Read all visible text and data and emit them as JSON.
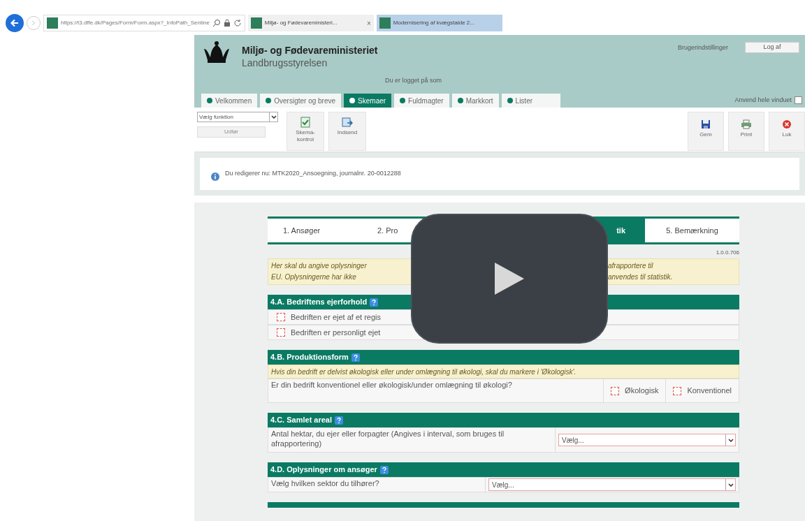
{
  "browser": {
    "url": "https://t3.dffe.dk/Pages/Form/Form.aspx?_InfoPath_Sentine",
    "tabs": [
      {
        "title": "Miljø- og Fødevareministeri...",
        "selected": false,
        "close": "×"
      },
      {
        "title": "Modernisering af kvægstalde 2...",
        "selected": true
      }
    ]
  },
  "header": {
    "ministry": "Miljø- og Fødevareministeriet",
    "agency": "Landbrugsstyrelsen",
    "logged_in": "Du er logget på som",
    "user_settings": "Brugerindstillinger",
    "logout": "Log af"
  },
  "nav_tabs": [
    {
      "label": "Velkommen",
      "selected": false
    },
    {
      "label": "Oversigter og breve",
      "selected": false
    },
    {
      "label": "Skemaer",
      "selected": true
    },
    {
      "label": "Fuldmagter",
      "selected": false
    },
    {
      "label": "Markkort",
      "selected": false
    },
    {
      "label": "Lister",
      "selected": false
    }
  ],
  "full_window": {
    "label": "Anvend hele vinduet",
    "checked": false
  },
  "toolbar": {
    "function_select": "Vælg funktion",
    "run_button": {
      "label": "Udfør",
      "disabled": true
    },
    "left_buttons": [
      {
        "label": "Skema-kontrol",
        "kind": "check"
      },
      {
        "label": "Indsend",
        "kind": "send"
      }
    ],
    "right_buttons": [
      {
        "label": "Gem",
        "kind": "save"
      },
      {
        "label": "Print",
        "kind": "print"
      },
      {
        "label": "Luk",
        "kind": "close"
      }
    ]
  },
  "info": "Du redigerer nu: MTK2020_Ansoegning, journalnr. 20-0012288",
  "steps": [
    {
      "label": "1. Ansøger",
      "selected": false
    },
    {
      "label": "2. Pro",
      "selected": false
    },
    {
      "label": "tik",
      "selected": true
    },
    {
      "label": "5. Bemærkning",
      "selected": false
    }
  ],
  "version": "1.0.0.706",
  "intro": [
    {
      "left": "Her skal du angive oplysninger",
      "right": "afrapportere til"
    },
    {
      "left": "EU. Oplysningerne har ikke",
      "right": "anvendes til statistik."
    }
  ],
  "sections": [
    {
      "title": "4.A. Bedriftens ejerforhold",
      "rows": [
        {
          "kind": "checkbox",
          "label": "Bedriften er ejet af et regis",
          "checked": false
        },
        {
          "kind": "checkbox",
          "label": "Bedriften er personligt ejet",
          "checked": false
        }
      ]
    },
    {
      "title": "4.B. Produktionsform",
      "rows": [
        {
          "kind": "note",
          "label": "Hvis din bedrift er delvist økologisk eller under omlægning til økologi, skal du markere i 'Økologisk'."
        },
        {
          "kind": "options",
          "label": "Er din bedrift konventionel eller økologisk/under omlægning til økologi?",
          "options": [
            {
              "label": "Økologisk",
              "checked": false
            },
            {
              "label": "Konventionel",
              "checked": false
            }
          ]
        }
      ]
    },
    {
      "title": "4.C. Samlet areal",
      "rows": [
        {
          "kind": "select",
          "label": "Antal hektar, du ejer eller forpagter (Angives i interval, som bruges til afrapportering)",
          "placeholder": "Vælg..."
        }
      ]
    },
    {
      "title": "4.D. Oplysninger om ansøger",
      "rows": [
        {
          "kind": "select",
          "label": "Vælg hvilken sektor du tilhører?",
          "placeholder": "Vælg..."
        }
      ]
    }
  ]
}
